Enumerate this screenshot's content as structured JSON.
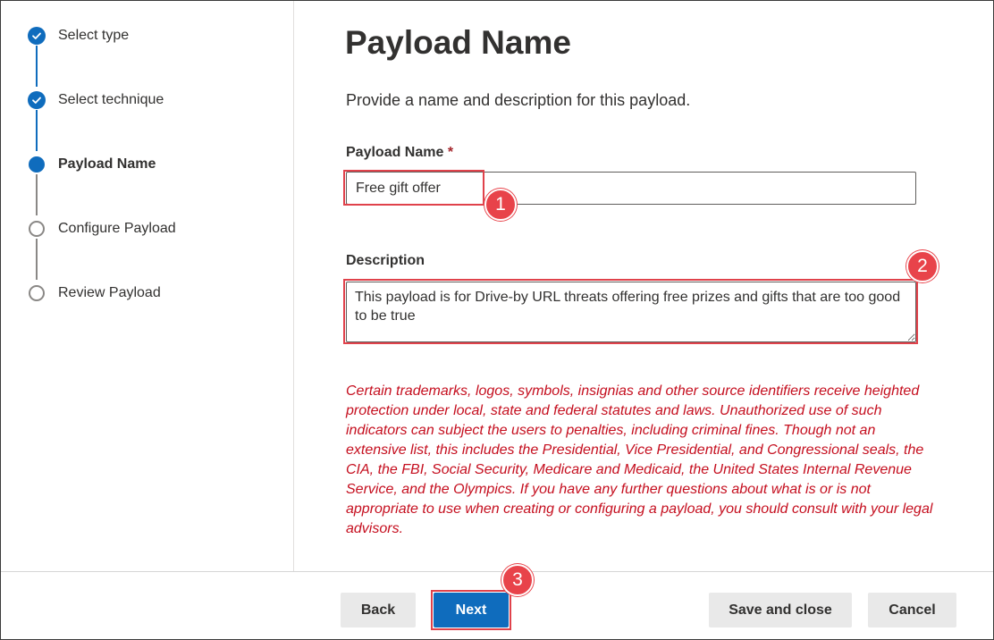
{
  "steps": [
    {
      "label": "Select type",
      "status": "done"
    },
    {
      "label": "Select technique",
      "status": "done"
    },
    {
      "label": "Payload Name",
      "status": "current"
    },
    {
      "label": "Configure Payload",
      "status": "pending"
    },
    {
      "label": "Review Payload",
      "status": "pending"
    }
  ],
  "page": {
    "title": "Payload Name",
    "subtitle": "Provide a name and description for this payload."
  },
  "form": {
    "name_label": "Payload Name",
    "required_marker": "*",
    "name_value": "Free gift offer",
    "description_label": "Description",
    "description_value": "This payload is for Drive-by URL threats offering free prizes and gifts that are too good to be true"
  },
  "warning_text": "Certain trademarks, logos, symbols, insignias and other source identifiers receive heighted protection under local, state and federal statutes and laws. Unauthorized use of such indicators can subject the users to penalties, including criminal fines. Though not an extensive list, this includes the Presidential, Vice Presidential, and Congressional seals, the CIA, the FBI, Social Security, Medicare and Medicaid, the United States Internal Revenue Service, and the Olympics. If you have any further questions about what is or is not appropriate to use when creating or configuring a payload, you should consult with your legal advisors.",
  "annotations": [
    "1",
    "2",
    "3"
  ],
  "footer": {
    "back": "Back",
    "next": "Next",
    "save_close": "Save and close",
    "cancel": "Cancel"
  },
  "colors": {
    "accent": "#0f6cbd",
    "annotation": "#e8434a",
    "warning": "#c50f1f"
  },
  "icons": {
    "done": "checkmark-icon"
  }
}
